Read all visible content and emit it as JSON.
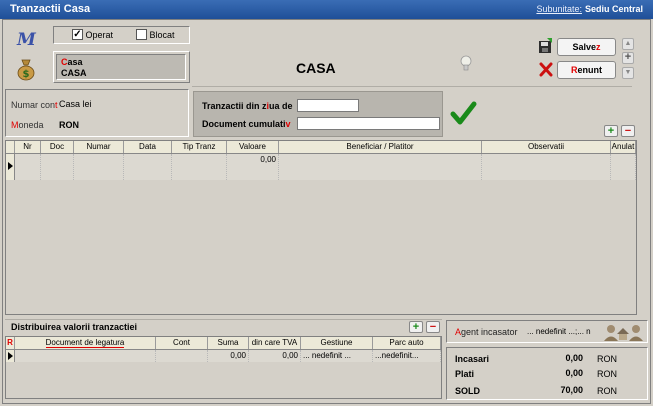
{
  "window": {
    "title": "Tranzactii Casa",
    "subunit_label": "Subunitate:",
    "subunit_value": "Sediu Central"
  },
  "filters": {
    "operat_label": "Operat",
    "operat_checked": true,
    "blocat_label": "Blocat",
    "blocat_checked": false
  },
  "account_box": {
    "line1_accent": "C",
    "line1_rest": "asa",
    "line2": "CASA"
  },
  "heading": "CASA",
  "actions": {
    "save_accent": "z",
    "save_pre": "Salve",
    "cancel_accent": "R",
    "cancel_rest": "enunt"
  },
  "info": {
    "cont_label_pre": "Numar con",
    "cont_label_accent": "t",
    "cont_value": "Casa lei",
    "moneda_label_accent": "M",
    "moneda_label_rest": "oneda",
    "moneda_value": "RON"
  },
  "criteria": {
    "day_label_pre": "Tranzactii din z",
    "day_label_accent": "i",
    "day_label_post": "ua de",
    "day_value": "",
    "doc_label_pre": "Document cumulati",
    "doc_label_accent": "v",
    "doc_value": ""
  },
  "main_table": {
    "columns": [
      "Nr",
      "Doc",
      "Numar",
      "Data",
      "Tip Tranz",
      "Valoare",
      "Beneficiar  / Platitor",
      "Observatii",
      "Anulat"
    ],
    "row": {
      "nr": "",
      "doc": "",
      "numar": "",
      "data": "",
      "tip": "",
      "valoare": "0,00",
      "beneficiar": "",
      "observatii": "",
      "anulat": ""
    }
  },
  "distribution": {
    "title": "Distribuirea valorii tranzactiei",
    "columns": [
      "Document de legatura",
      "Cont",
      "Suma",
      "din care TVA",
      "Gestiune",
      "Parc auto"
    ],
    "row": {
      "document": "",
      "cont": "",
      "suma": "0,00",
      "tva": "0,00",
      "gestiune": "... nedefinit ...",
      "parc": "...nedefinit..."
    },
    "marker": "R"
  },
  "agent": {
    "label_accent": "A",
    "label_rest": "gent incasator",
    "value": "... nedefinit ...;... n"
  },
  "totals": {
    "incasari_label": "Incasari",
    "incasari_value": "0,00",
    "incasari_currency": "RON",
    "plati_label": "Plati",
    "plati_value": "0,00",
    "plati_currency": "RON",
    "sold_label": "SOLD",
    "sold_value": "70,00",
    "sold_currency": "RON"
  },
  "colors": {
    "titlebar": "#2a5ea8",
    "accent_red": "#e00000",
    "check_green": "#1a8a1a"
  }
}
